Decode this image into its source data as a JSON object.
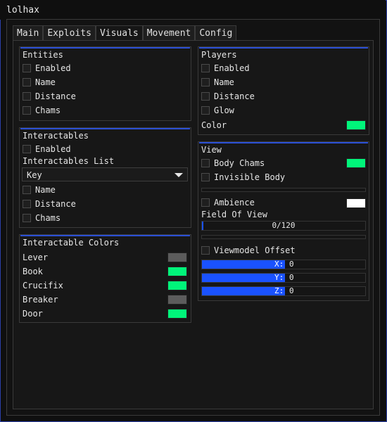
{
  "window": {
    "title": "lolhax"
  },
  "tabs": [
    {
      "label": "Main"
    },
    {
      "label": "Exploits"
    },
    {
      "label": "Visuals"
    },
    {
      "label": "Movement"
    },
    {
      "label": "Config"
    }
  ],
  "entities": {
    "title": "Entities",
    "items": [
      {
        "label": "Enabled"
      },
      {
        "label": "Name"
      },
      {
        "label": "Distance"
      },
      {
        "label": "Chams"
      }
    ]
  },
  "interactables": {
    "title": "Interactables",
    "enabled_label": "Enabled",
    "list_label": "Interactables List",
    "list_value": "Key",
    "items": [
      {
        "label": "Name"
      },
      {
        "label": "Distance"
      },
      {
        "label": "Chams"
      }
    ]
  },
  "interactable_colors": {
    "title": "Interactable Colors",
    "items": [
      {
        "label": "Lever",
        "color": "#5c5c5c"
      },
      {
        "label": "Book",
        "color": "#00f57a"
      },
      {
        "label": "Crucifix",
        "color": "#00f57a"
      },
      {
        "label": "Breaker",
        "color": "#5c5c5c"
      },
      {
        "label": "Door",
        "color": "#00f57a"
      }
    ]
  },
  "players": {
    "title": "Players",
    "items": [
      {
        "label": "Enabled"
      },
      {
        "label": "Name"
      },
      {
        "label": "Distance"
      },
      {
        "label": "Glow"
      }
    ],
    "color_label": "Color",
    "color": "#00f57a"
  },
  "view": {
    "title": "View",
    "body_chams_label": "Body Chams",
    "body_chams_color": "#00f57a",
    "invisible_body_label": "Invisible Body",
    "ambience_label": "Ambience",
    "ambience_color": "#ffffff",
    "fov_label": "Field Of View",
    "fov_value": "0/120",
    "fov_fraction": 0.0,
    "viewmodel_label": "Viewmodel Offset",
    "offsets": [
      {
        "axis": "X:",
        "value": "0"
      },
      {
        "axis": "Y:",
        "value": "0"
      },
      {
        "axis": "Z:",
        "value": "0"
      }
    ]
  },
  "colors": {
    "accent": "#2a4fd6",
    "slider_fill": "#1a52ff",
    "border": "#2b3fa8"
  }
}
